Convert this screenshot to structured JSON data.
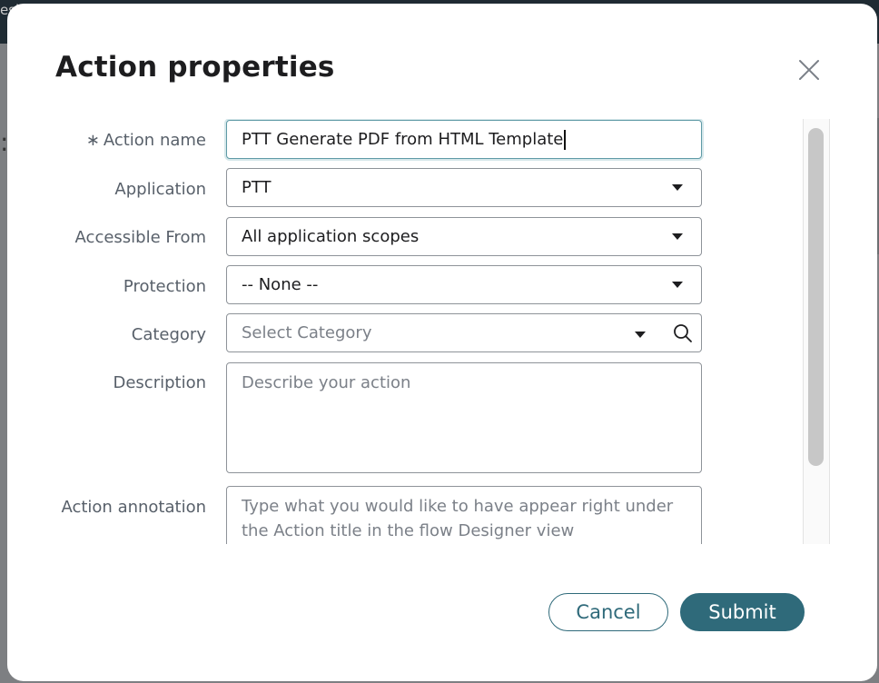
{
  "backdrop": {
    "partial_text": "esi",
    "partial_glyph": ":"
  },
  "dialog": {
    "title": "Action properties",
    "close_icon": "close-icon"
  },
  "form": {
    "action_name": {
      "required_mark": "∗",
      "label": "Action name",
      "value": "PTT Generate PDF from HTML Template"
    },
    "application": {
      "label": "Application",
      "value": "PTT"
    },
    "accessible_from": {
      "label": "Accessible From",
      "value": "All application scopes"
    },
    "protection": {
      "label": "Protection",
      "value": "-- None --"
    },
    "category": {
      "label": "Category",
      "placeholder": "Select Category",
      "search_icon": "search-icon"
    },
    "description": {
      "label": "Description",
      "placeholder": "Describe your action"
    },
    "action_annotation": {
      "label": "Action annotation",
      "placeholder": "Type what you would like to have appear right under the Action title in the flow Designer view"
    }
  },
  "buttons": {
    "cancel": "Cancel",
    "submit": "Submit"
  },
  "colors": {
    "primary": "#2f6a7a",
    "focus_border": "#5f9aa6",
    "label_text": "#58606a"
  }
}
